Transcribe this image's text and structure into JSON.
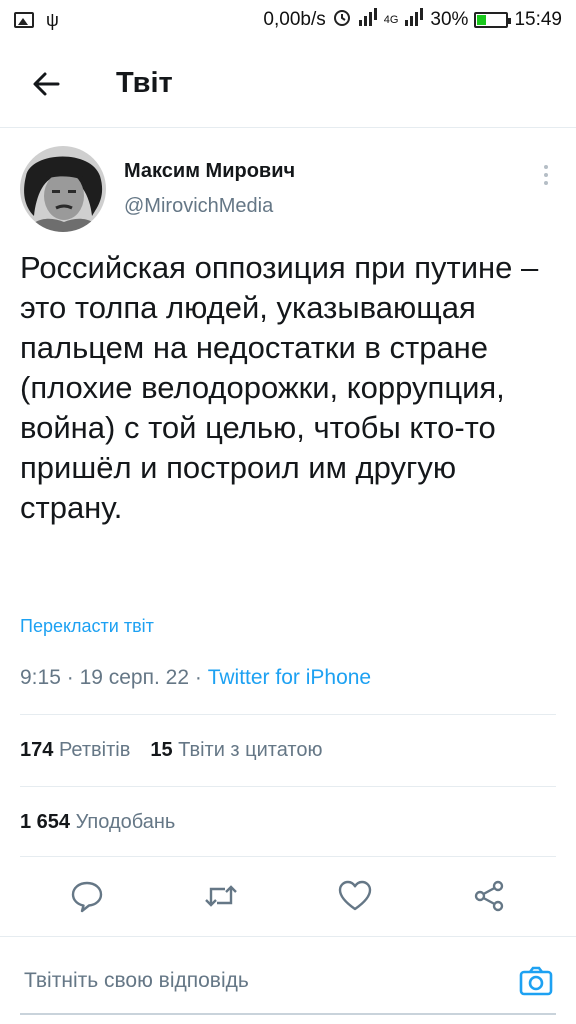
{
  "status_bar": {
    "speed": "0,00b/s",
    "network_4g": "4G",
    "battery": "30%",
    "battery_level": 0.3,
    "time": "15:49"
  },
  "header": {
    "title": "Твіт"
  },
  "tweet": {
    "author_name": "Максим Мирович",
    "author_handle": "@MirovichMedia",
    "text": "Российская оппозиция при путине – это толпа людей, указывающая пальцем на недостатки в стране (плохие велодорожки, коррупция, война) с той целью, чтобы кто-то пришёл и построил им другую страну.",
    "translate_label": "Перекласти твіт",
    "time": "9:15",
    "date": "19 серп. 22",
    "separator": "·",
    "source": "Twitter for iPhone"
  },
  "stats": {
    "retweets_count": "174",
    "retweets_label": "Ретвітів",
    "quotes_count": "15",
    "quotes_label": "Твіти з цитатою",
    "likes_count": "1 654",
    "likes_label": "Уподобань"
  },
  "reply": {
    "placeholder": "Твітніть свою відповідь"
  },
  "colors": {
    "accent": "#1da1f2",
    "secondary_text": "#657786",
    "primary_text": "#14171a",
    "divider": "#e6ecf0"
  }
}
